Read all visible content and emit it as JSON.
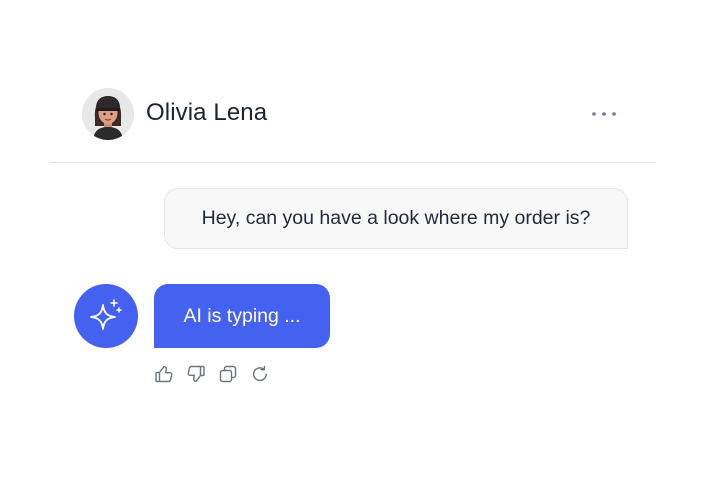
{
  "conversation": {
    "contact_name": "Olivia Lena"
  },
  "messages": {
    "user_message": "Hey, can you have a look where my order is?",
    "ai_status": "AI is typing ..."
  },
  "colors": {
    "accent": "#4461f0",
    "text_primary": "#1a2438",
    "bubble_bg": "#f8f8f8",
    "divider": "#e2e4e8",
    "icon_gray": "#6b7280"
  },
  "icons": {
    "header_menu": "more-horizontal-icon",
    "ai_avatar": "sparkles-icon",
    "actions": [
      "thumbs-up-icon",
      "thumbs-down-icon",
      "copy-icon",
      "refresh-icon"
    ]
  }
}
